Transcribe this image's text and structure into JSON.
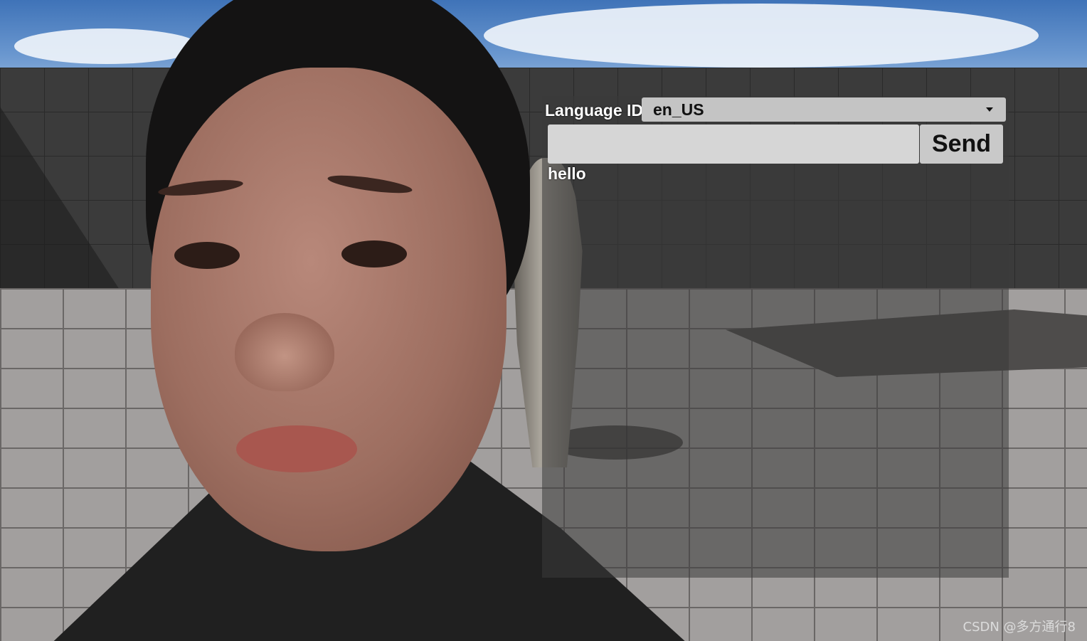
{
  "overlay": {
    "language_label": "Language ID:",
    "language_selected": "en_US",
    "input_value": "",
    "send_label": "Send",
    "messages": [
      "hello"
    ]
  },
  "watermark": "CSDN @多方通行8",
  "icons": {
    "dropdown": "chevron-down-icon"
  }
}
